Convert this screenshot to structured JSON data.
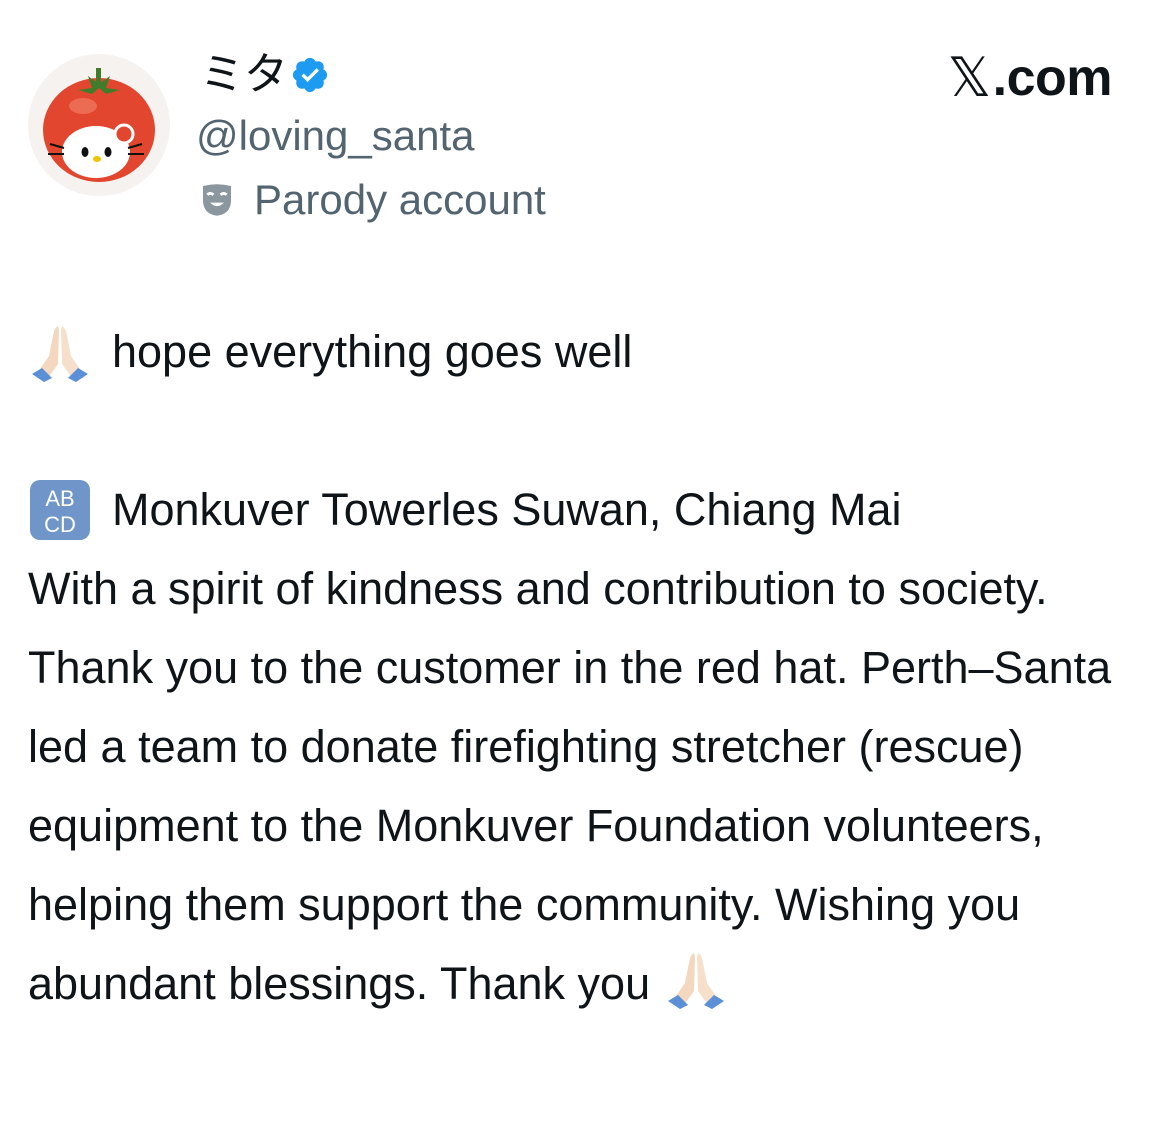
{
  "header": {
    "avatar_icon": "hello-kitty-tomato-avatar",
    "display_name": "ミタ",
    "verified_icon": "verified-badge-icon",
    "handle": "@loving_santa",
    "parody_icon": "theater-mask-icon",
    "parody_label": "Parody account",
    "brand": ".com",
    "brand_x": "𝕏"
  },
  "tweet": {
    "line1_emoji": "folded-hands-icon",
    "line1": "hope everything goes well",
    "line2_emoji": "abcd-input-icon",
    "line2": "Monkuver Towerles Suwan, Chiang Mai",
    "body": "With a spirit of kindness and contribution to society. Thank you to the customer in the red hat. Perth–Santa led a team to donate firefighting stretcher (rescue) equipment to the Monkuver Foundation volunteers, helping them support the community. Wishing you abundant blessings. Thank you",
    "end_emoji": "folded-hands-icon"
  },
  "colors": {
    "text": "#0f1419",
    "secondary": "#536471",
    "verified_blue": "#1d9bf0"
  }
}
